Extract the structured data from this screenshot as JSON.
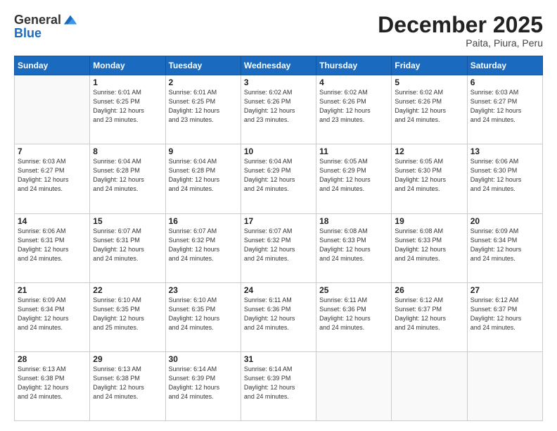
{
  "header": {
    "logo": {
      "general": "General",
      "blue": "Blue"
    },
    "title": "December 2025",
    "subtitle": "Paita, Piura, Peru"
  },
  "calendar": {
    "weekdays": [
      "Sunday",
      "Monday",
      "Tuesday",
      "Wednesday",
      "Thursday",
      "Friday",
      "Saturday"
    ],
    "weeks": [
      [
        {
          "day": "",
          "sunrise": "",
          "sunset": "",
          "daylight": ""
        },
        {
          "day": "1",
          "sunrise": "Sunrise: 6:01 AM",
          "sunset": "Sunset: 6:25 PM",
          "daylight": "Daylight: 12 hours and 23 minutes."
        },
        {
          "day": "2",
          "sunrise": "Sunrise: 6:01 AM",
          "sunset": "Sunset: 6:25 PM",
          "daylight": "Daylight: 12 hours and 23 minutes."
        },
        {
          "day": "3",
          "sunrise": "Sunrise: 6:02 AM",
          "sunset": "Sunset: 6:26 PM",
          "daylight": "Daylight: 12 hours and 23 minutes."
        },
        {
          "day": "4",
          "sunrise": "Sunrise: 6:02 AM",
          "sunset": "Sunset: 6:26 PM",
          "daylight": "Daylight: 12 hours and 23 minutes."
        },
        {
          "day": "5",
          "sunrise": "Sunrise: 6:02 AM",
          "sunset": "Sunset: 6:26 PM",
          "daylight": "Daylight: 12 hours and 24 minutes."
        },
        {
          "day": "6",
          "sunrise": "Sunrise: 6:03 AM",
          "sunset": "Sunset: 6:27 PM",
          "daylight": "Daylight: 12 hours and 24 minutes."
        }
      ],
      [
        {
          "day": "7",
          "sunrise": "Sunrise: 6:03 AM",
          "sunset": "Sunset: 6:27 PM",
          "daylight": "Daylight: 12 hours and 24 minutes."
        },
        {
          "day": "8",
          "sunrise": "Sunrise: 6:04 AM",
          "sunset": "Sunset: 6:28 PM",
          "daylight": "Daylight: 12 hours and 24 minutes."
        },
        {
          "day": "9",
          "sunrise": "Sunrise: 6:04 AM",
          "sunset": "Sunset: 6:28 PM",
          "daylight": "Daylight: 12 hours and 24 minutes."
        },
        {
          "day": "10",
          "sunrise": "Sunrise: 6:04 AM",
          "sunset": "Sunset: 6:29 PM",
          "daylight": "Daylight: 12 hours and 24 minutes."
        },
        {
          "day": "11",
          "sunrise": "Sunrise: 6:05 AM",
          "sunset": "Sunset: 6:29 PM",
          "daylight": "Daylight: 12 hours and 24 minutes."
        },
        {
          "day": "12",
          "sunrise": "Sunrise: 6:05 AM",
          "sunset": "Sunset: 6:30 PM",
          "daylight": "Daylight: 12 hours and 24 minutes."
        },
        {
          "day": "13",
          "sunrise": "Sunrise: 6:06 AM",
          "sunset": "Sunset: 6:30 PM",
          "daylight": "Daylight: 12 hours and 24 minutes."
        }
      ],
      [
        {
          "day": "14",
          "sunrise": "Sunrise: 6:06 AM",
          "sunset": "Sunset: 6:31 PM",
          "daylight": "Daylight: 12 hours and 24 minutes."
        },
        {
          "day": "15",
          "sunrise": "Sunrise: 6:07 AM",
          "sunset": "Sunset: 6:31 PM",
          "daylight": "Daylight: 12 hours and 24 minutes."
        },
        {
          "day": "16",
          "sunrise": "Sunrise: 6:07 AM",
          "sunset": "Sunset: 6:32 PM",
          "daylight": "Daylight: 12 hours and 24 minutes."
        },
        {
          "day": "17",
          "sunrise": "Sunrise: 6:07 AM",
          "sunset": "Sunset: 6:32 PM",
          "daylight": "Daylight: 12 hours and 24 minutes."
        },
        {
          "day": "18",
          "sunrise": "Sunrise: 6:08 AM",
          "sunset": "Sunset: 6:33 PM",
          "daylight": "Daylight: 12 hours and 24 minutes."
        },
        {
          "day": "19",
          "sunrise": "Sunrise: 6:08 AM",
          "sunset": "Sunset: 6:33 PM",
          "daylight": "Daylight: 12 hours and 24 minutes."
        },
        {
          "day": "20",
          "sunrise": "Sunrise: 6:09 AM",
          "sunset": "Sunset: 6:34 PM",
          "daylight": "Daylight: 12 hours and 24 minutes."
        }
      ],
      [
        {
          "day": "21",
          "sunrise": "Sunrise: 6:09 AM",
          "sunset": "Sunset: 6:34 PM",
          "daylight": "Daylight: 12 hours and 24 minutes."
        },
        {
          "day": "22",
          "sunrise": "Sunrise: 6:10 AM",
          "sunset": "Sunset: 6:35 PM",
          "daylight": "Daylight: 12 hours and 25 minutes."
        },
        {
          "day": "23",
          "sunrise": "Sunrise: 6:10 AM",
          "sunset": "Sunset: 6:35 PM",
          "daylight": "Daylight: 12 hours and 24 minutes."
        },
        {
          "day": "24",
          "sunrise": "Sunrise: 6:11 AM",
          "sunset": "Sunset: 6:36 PM",
          "daylight": "Daylight: 12 hours and 24 minutes."
        },
        {
          "day": "25",
          "sunrise": "Sunrise: 6:11 AM",
          "sunset": "Sunset: 6:36 PM",
          "daylight": "Daylight: 12 hours and 24 minutes."
        },
        {
          "day": "26",
          "sunrise": "Sunrise: 6:12 AM",
          "sunset": "Sunset: 6:37 PM",
          "daylight": "Daylight: 12 hours and 24 minutes."
        },
        {
          "day": "27",
          "sunrise": "Sunrise: 6:12 AM",
          "sunset": "Sunset: 6:37 PM",
          "daylight": "Daylight: 12 hours and 24 minutes."
        }
      ],
      [
        {
          "day": "28",
          "sunrise": "Sunrise: 6:13 AM",
          "sunset": "Sunset: 6:38 PM",
          "daylight": "Daylight: 12 hours and 24 minutes."
        },
        {
          "day": "29",
          "sunrise": "Sunrise: 6:13 AM",
          "sunset": "Sunset: 6:38 PM",
          "daylight": "Daylight: 12 hours and 24 minutes."
        },
        {
          "day": "30",
          "sunrise": "Sunrise: 6:14 AM",
          "sunset": "Sunset: 6:39 PM",
          "daylight": "Daylight: 12 hours and 24 minutes."
        },
        {
          "day": "31",
          "sunrise": "Sunrise: 6:14 AM",
          "sunset": "Sunset: 6:39 PM",
          "daylight": "Daylight: 12 hours and 24 minutes."
        },
        {
          "day": "",
          "sunrise": "",
          "sunset": "",
          "daylight": ""
        },
        {
          "day": "",
          "sunrise": "",
          "sunset": "",
          "daylight": ""
        },
        {
          "day": "",
          "sunrise": "",
          "sunset": "",
          "daylight": ""
        }
      ]
    ]
  }
}
